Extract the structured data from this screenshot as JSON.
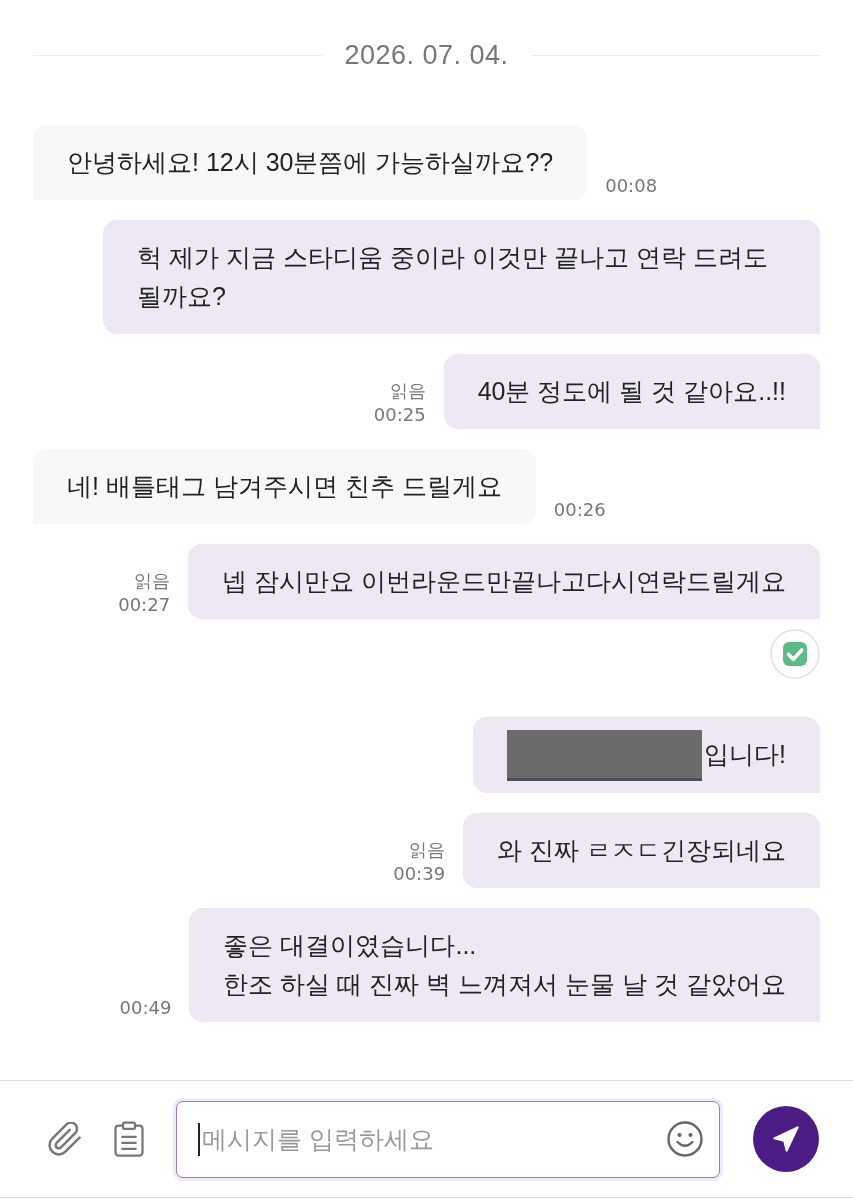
{
  "date_divider": "2026. 07. 04.",
  "messages": [
    {
      "kind": "incoming",
      "text": "안녕하세요! 12시 30분쯤에 가능하실까요??",
      "time": "00:08"
    },
    {
      "kind": "outgoing",
      "text": "헉 제가 지금 스타디움 중이라 이것만 끝나고 연락 드려도 될까요?"
    },
    {
      "kind": "outgoing",
      "text": "40분 정도에 될 것 같아요..!!",
      "read_label": "읽음",
      "time": "00:25"
    },
    {
      "kind": "incoming",
      "text": "네! 배틀태그 남겨주시면 친추 드릴게요",
      "time": "00:26"
    },
    {
      "kind": "outgoing",
      "text": "넵 잠시만요 이번라운드만끝나고다시연락드릴게요",
      "read_label": "읽음",
      "time": "00:27"
    },
    {
      "kind": "check"
    },
    {
      "kind": "outgoing",
      "redacted": true,
      "text": "입니다!"
    },
    {
      "kind": "outgoing",
      "text": "와 진짜 ㄹㅈㄷ긴장되네요",
      "read_label": "읽음",
      "time": "00:39"
    },
    {
      "kind": "outgoing",
      "text": "좋은 대결이였습니다...\n한조 하실 때 진짜 벽 느껴져서 눈물 날 것 같았어요",
      "time": "00:49"
    }
  ],
  "composer": {
    "placeholder": "메시지를 입력하세요",
    "focused": true
  }
}
